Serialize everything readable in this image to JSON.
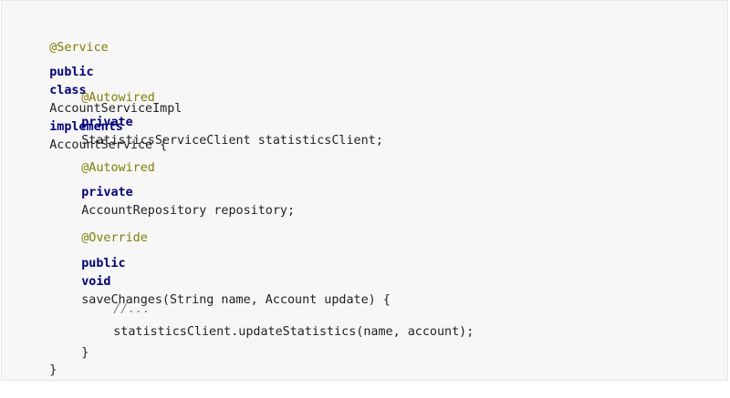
{
  "code": {
    "lines": {
      "l1": {
        "annotation": "@Service"
      },
      "l2": {
        "kw1": "public",
        "kw2": "class",
        "name": "AccountServiceImpl",
        "kw3": "implements",
        "iface": "AccountService {"
      },
      "l3": {
        "annotation": "@Autowired"
      },
      "l4": {
        "kw": "private",
        "rest": "StatisticsServiceClient statisticsClient;"
      },
      "l5": {
        "annotation": "@Autowired"
      },
      "l6": {
        "kw": "private",
        "rest": "AccountRepository repository;"
      },
      "l7": {
        "annotation": "@Override"
      },
      "l8": {
        "kw1": "public",
        "kw2": "void",
        "rest": "saveChanges(String name, Account update) {"
      },
      "l9": {
        "comment": "//..."
      },
      "l10": {
        "text": "statisticsClient.updateStatistics(name, account);"
      },
      "l11": {
        "text": "}"
      },
      "l12": {
        "text": "}"
      }
    }
  },
  "colors": {
    "annotation": "#808000",
    "keyword": "#000080",
    "text": "#222222",
    "comment": "#808080",
    "background": "#f7f7f7"
  }
}
